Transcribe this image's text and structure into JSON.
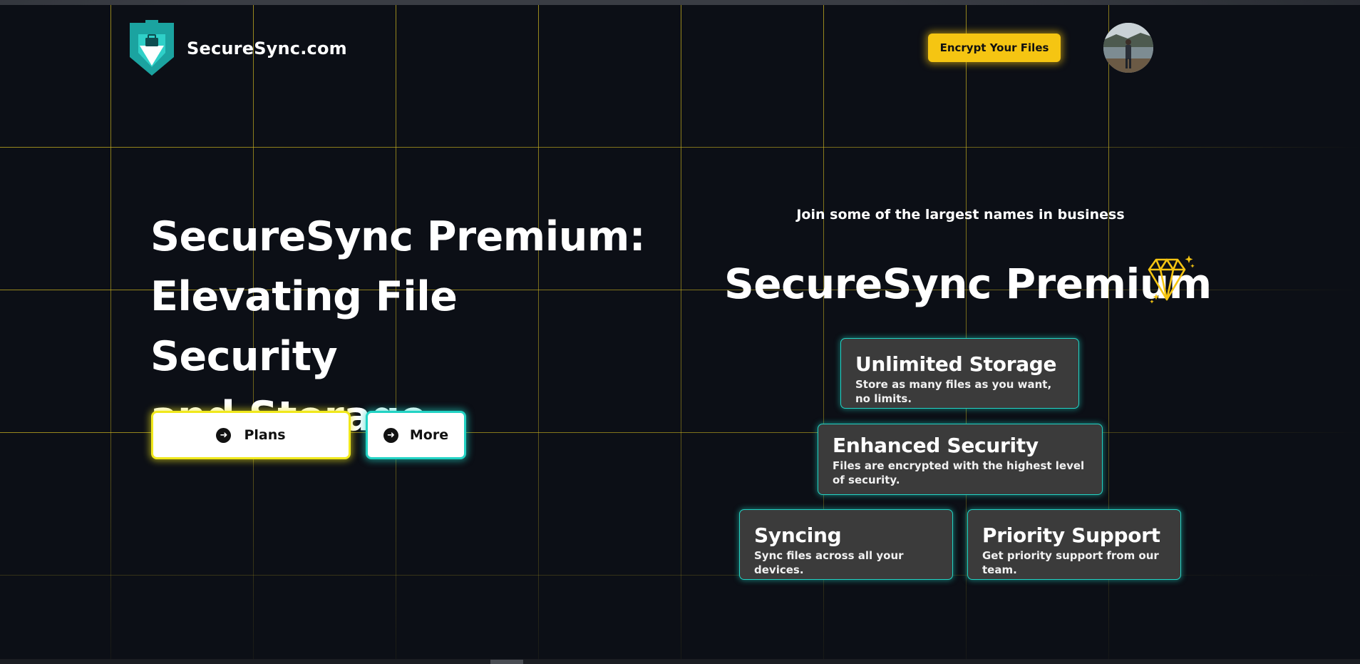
{
  "header": {
    "brand": "SecureSync.com",
    "cta_label": "Encrypt Your Files",
    "logo_icon": "shield-briefcase-icon",
    "avatar_icon": "user-avatar"
  },
  "hero": {
    "title_line1": "SecureSync Premium:",
    "title_line2": "Elevating File Security",
    "title_line3": "and Storage.",
    "buttons": [
      {
        "label": "Plans",
        "icon": "arrow-right-circle-icon"
      },
      {
        "label": "More",
        "icon": "arrow-right-circle-icon"
      }
    ]
  },
  "premium": {
    "tagline": "Join some of the largest names in business",
    "title": "SecureSync Premium",
    "title_icon": "sparkling-diamond-icon",
    "features": [
      {
        "title": "Unlimited Storage",
        "description": "Store as many files as you want, no limits."
      },
      {
        "title": "Enhanced Security",
        "description": "Files are encrypted with the highest level of security."
      },
      {
        "title": "Syncing",
        "description": "Sync files across all your devices."
      },
      {
        "title": "Priority Support",
        "description": "Get priority support from our team."
      }
    ]
  },
  "colors": {
    "background": "#0c0f16",
    "grid": "#c9b220",
    "accent_yellow": "#f5c512",
    "accent_teal": "#22d3c4",
    "card_bg": "#3b3b3b"
  }
}
